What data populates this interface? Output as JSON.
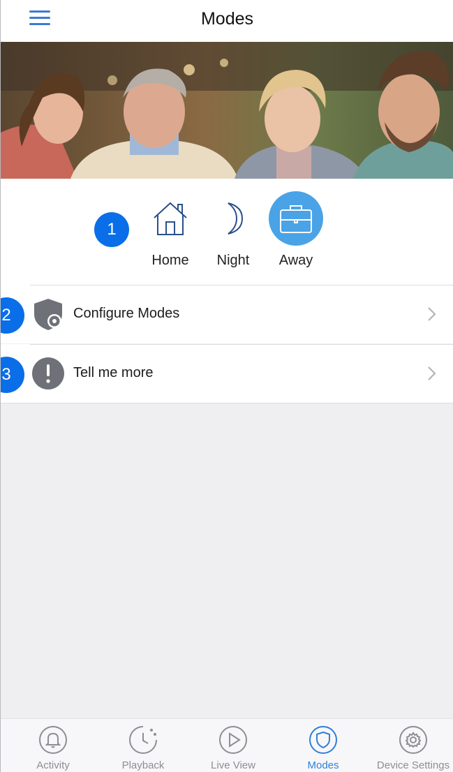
{
  "header": {
    "title": "Modes"
  },
  "modes": [
    {
      "key": "home",
      "label": "Home",
      "icon": "house-icon",
      "selected": false
    },
    {
      "key": "night",
      "label": "Night",
      "icon": "crescent-moon-icon",
      "selected": false
    },
    {
      "key": "away",
      "label": "Away",
      "icon": "briefcase-icon",
      "selected": true
    }
  ],
  "callouts": [
    "1",
    "2",
    "3"
  ],
  "list": [
    {
      "label": "Configure Modes",
      "icon": "shield-gear-icon"
    },
    {
      "label": "Tell me more",
      "icon": "exclamation-icon"
    }
  ],
  "tabs": [
    {
      "label": "Activity",
      "icon": "bell-icon",
      "active": false
    },
    {
      "label": "Playback",
      "icon": "clock-icon",
      "active": false
    },
    {
      "label": "Live View",
      "icon": "play-icon",
      "active": false
    },
    {
      "label": "Modes",
      "icon": "shield-icon",
      "active": true
    },
    {
      "label": "Device Settings",
      "icon": "gear-icon",
      "active": false
    }
  ],
  "colors": {
    "accent": "#3a7bd5",
    "callout": "#0a6ee8",
    "away_selected": "#4aa3e6",
    "icon_outline": "#2a4f8a"
  }
}
